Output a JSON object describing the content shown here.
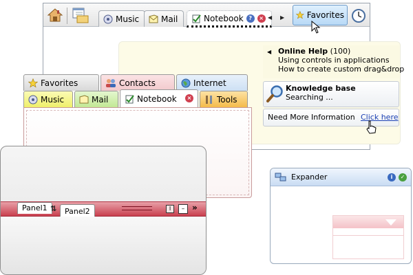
{
  "top_tabs": {
    "music_label": "Music",
    "mail_label": "Mail",
    "notebook_label": "Notebook",
    "favorites_label": "Favorites"
  },
  "popup": {
    "help_title": "Online Help",
    "help_count": "(100)",
    "help_line1": "Using controls in applications",
    "help_line2": "How to create custom drag&drop",
    "kb_title": "Knowledge base",
    "kb_status": "Searching ...",
    "info_text": "Need More Information",
    "info_link": "Click here"
  },
  "colored_tabs": {
    "row1": [
      "Favorites",
      "Contacts",
      "Internet"
    ],
    "row2": [
      "Music",
      "Mail",
      "Notebook",
      "Tools"
    ]
  },
  "panels": {
    "panel1_label": "Panel1",
    "panel2_label": "Panel2"
  },
  "expander": {
    "title": "Expander"
  },
  "colors": {
    "favorites_tab": "#d8d8d8",
    "contacts_tab": "#f2c9cc",
    "internet_tab": "#cde0f4",
    "music_tab": "#f2f27a",
    "mail_tab": "#c9ec9f",
    "tools_tab": "#f7c766",
    "panel_strip": "#c9404f",
    "expander_header": "#c9dcf3",
    "link": "#1a3fb3"
  }
}
